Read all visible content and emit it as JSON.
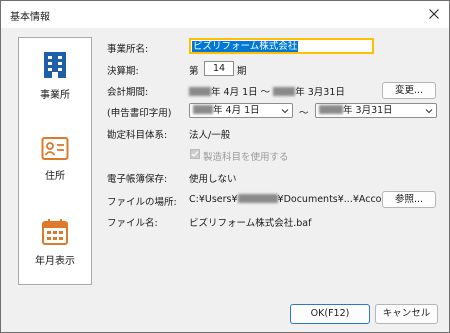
{
  "window": {
    "title": "基本情報"
  },
  "nav": {
    "items": [
      {
        "label": "事業所",
        "icon": "building-icon",
        "selected": true
      },
      {
        "label": "住所",
        "icon": "contact-card-icon",
        "selected": false
      },
      {
        "label": "年月表示",
        "icon": "calendar-icon",
        "selected": false
      }
    ]
  },
  "form": {
    "business_name_label": "事業所名:",
    "business_name_value": "ビズリフォーム株式会社",
    "period_label": "決算期:",
    "period_prefix": "第",
    "period_value": "14",
    "period_suffix": "期",
    "accounting_label": "会計期間:",
    "accounting_start": "年 4月 1日",
    "accounting_tilde": "〜",
    "accounting_end": "年 3月31日",
    "change_button": "変更...",
    "declaration_label": "(申告書印字用)",
    "declaration_start": "年 4月 1日",
    "declaration_tilde": "〜",
    "declaration_end": "年 3月31日",
    "subject_system_label": "勘定科目体系:",
    "subject_system_value": "法人/一般",
    "manufacturing_checkbox": "製造科目を使用する",
    "manufacturing_checked": true,
    "e_book_label": "電子帳簿保存:",
    "e_book_value": "使用しない",
    "file_location_label": "ファイルの場所:",
    "file_location_prefix": "C:¥Users¥",
    "file_location_suffix": "¥Documents¥...¥Account",
    "browse_button": "参照...",
    "file_name_label": "ファイル名:",
    "file_name_value": "ビズリフォーム株式会社.baf"
  },
  "footer": {
    "ok_button": "OK(F12)",
    "cancel_button": "キャンセル"
  },
  "colors": {
    "accent": "#2e78c7",
    "nav_icon": "#1f5fa8",
    "nav_icon_alt": "#e0782a",
    "focus": "#ffc000",
    "selection": "#0078d7"
  }
}
